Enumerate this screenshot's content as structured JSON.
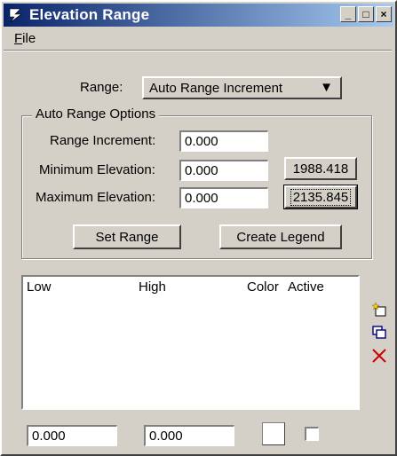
{
  "window": {
    "title": "Elevation Range",
    "app_icon": "bentley-b-icon",
    "controls": {
      "minimize": "_",
      "maximize": "□",
      "close": "×"
    }
  },
  "menu": {
    "file_prefix": "F",
    "file_rest": "ile"
  },
  "range": {
    "label": "Range:",
    "selected": "Auto Range Increment",
    "arrow": "▼"
  },
  "auto_range_options": {
    "legend": "Auto Range Options",
    "range_increment_label": "Range Increment:",
    "range_increment_value": "0.000",
    "min_label": "Minimum Elevation:",
    "min_value": "0.000",
    "min_button": "1988.418",
    "max_label": "Maximum Elevation:",
    "max_value": "0.000",
    "max_button": "2135.845",
    "set_range": "Set Range",
    "create_legend": "Create Legend"
  },
  "table": {
    "columns": [
      "Low",
      "High",
      "Color",
      "Active"
    ],
    "rows": []
  },
  "side_tools": [
    "new-star-icon",
    "copy-icon",
    "delete-x-icon"
  ],
  "bottom": {
    "low_value": "0.000",
    "high_value": "0.000",
    "color": "#ffffff",
    "active_checked": false
  },
  "colors": {
    "title_start": "#0a246a",
    "title_end": "#a6caf0",
    "face": "#d4d0c8",
    "delete_red": "#cc0000"
  }
}
